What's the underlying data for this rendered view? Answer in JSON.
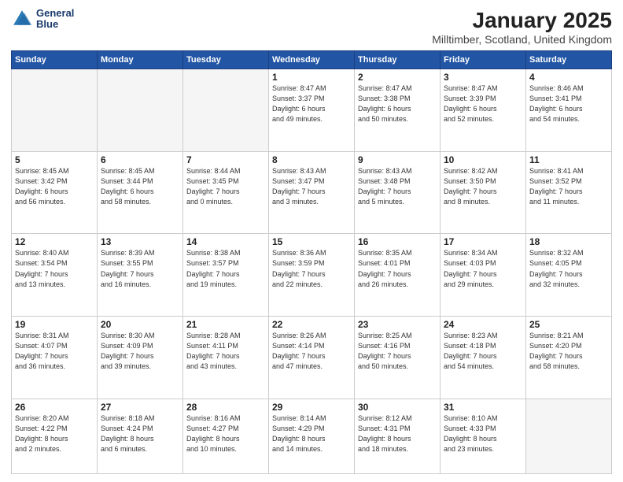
{
  "logo": {
    "line1": "General",
    "line2": "Blue"
  },
  "title": "January 2025",
  "subtitle": "Milltimber, Scotland, United Kingdom",
  "weekdays": [
    "Sunday",
    "Monday",
    "Tuesday",
    "Wednesday",
    "Thursday",
    "Friday",
    "Saturday"
  ],
  "weeks": [
    [
      {
        "day": "",
        "info": ""
      },
      {
        "day": "",
        "info": ""
      },
      {
        "day": "",
        "info": ""
      },
      {
        "day": "1",
        "info": "Sunrise: 8:47 AM\nSunset: 3:37 PM\nDaylight: 6 hours\nand 49 minutes."
      },
      {
        "day": "2",
        "info": "Sunrise: 8:47 AM\nSunset: 3:38 PM\nDaylight: 6 hours\nand 50 minutes."
      },
      {
        "day": "3",
        "info": "Sunrise: 8:47 AM\nSunset: 3:39 PM\nDaylight: 6 hours\nand 52 minutes."
      },
      {
        "day": "4",
        "info": "Sunrise: 8:46 AM\nSunset: 3:41 PM\nDaylight: 6 hours\nand 54 minutes."
      }
    ],
    [
      {
        "day": "5",
        "info": "Sunrise: 8:45 AM\nSunset: 3:42 PM\nDaylight: 6 hours\nand 56 minutes."
      },
      {
        "day": "6",
        "info": "Sunrise: 8:45 AM\nSunset: 3:44 PM\nDaylight: 6 hours\nand 58 minutes."
      },
      {
        "day": "7",
        "info": "Sunrise: 8:44 AM\nSunset: 3:45 PM\nDaylight: 7 hours\nand 0 minutes."
      },
      {
        "day": "8",
        "info": "Sunrise: 8:43 AM\nSunset: 3:47 PM\nDaylight: 7 hours\nand 3 minutes."
      },
      {
        "day": "9",
        "info": "Sunrise: 8:43 AM\nSunset: 3:48 PM\nDaylight: 7 hours\nand 5 minutes."
      },
      {
        "day": "10",
        "info": "Sunrise: 8:42 AM\nSunset: 3:50 PM\nDaylight: 7 hours\nand 8 minutes."
      },
      {
        "day": "11",
        "info": "Sunrise: 8:41 AM\nSunset: 3:52 PM\nDaylight: 7 hours\nand 11 minutes."
      }
    ],
    [
      {
        "day": "12",
        "info": "Sunrise: 8:40 AM\nSunset: 3:54 PM\nDaylight: 7 hours\nand 13 minutes."
      },
      {
        "day": "13",
        "info": "Sunrise: 8:39 AM\nSunset: 3:55 PM\nDaylight: 7 hours\nand 16 minutes."
      },
      {
        "day": "14",
        "info": "Sunrise: 8:38 AM\nSunset: 3:57 PM\nDaylight: 7 hours\nand 19 minutes."
      },
      {
        "day": "15",
        "info": "Sunrise: 8:36 AM\nSunset: 3:59 PM\nDaylight: 7 hours\nand 22 minutes."
      },
      {
        "day": "16",
        "info": "Sunrise: 8:35 AM\nSunset: 4:01 PM\nDaylight: 7 hours\nand 26 minutes."
      },
      {
        "day": "17",
        "info": "Sunrise: 8:34 AM\nSunset: 4:03 PM\nDaylight: 7 hours\nand 29 minutes."
      },
      {
        "day": "18",
        "info": "Sunrise: 8:32 AM\nSunset: 4:05 PM\nDaylight: 7 hours\nand 32 minutes."
      }
    ],
    [
      {
        "day": "19",
        "info": "Sunrise: 8:31 AM\nSunset: 4:07 PM\nDaylight: 7 hours\nand 36 minutes."
      },
      {
        "day": "20",
        "info": "Sunrise: 8:30 AM\nSunset: 4:09 PM\nDaylight: 7 hours\nand 39 minutes."
      },
      {
        "day": "21",
        "info": "Sunrise: 8:28 AM\nSunset: 4:11 PM\nDaylight: 7 hours\nand 43 minutes."
      },
      {
        "day": "22",
        "info": "Sunrise: 8:26 AM\nSunset: 4:14 PM\nDaylight: 7 hours\nand 47 minutes."
      },
      {
        "day": "23",
        "info": "Sunrise: 8:25 AM\nSunset: 4:16 PM\nDaylight: 7 hours\nand 50 minutes."
      },
      {
        "day": "24",
        "info": "Sunrise: 8:23 AM\nSunset: 4:18 PM\nDaylight: 7 hours\nand 54 minutes."
      },
      {
        "day": "25",
        "info": "Sunrise: 8:21 AM\nSunset: 4:20 PM\nDaylight: 7 hours\nand 58 minutes."
      }
    ],
    [
      {
        "day": "26",
        "info": "Sunrise: 8:20 AM\nSunset: 4:22 PM\nDaylight: 8 hours\nand 2 minutes."
      },
      {
        "day": "27",
        "info": "Sunrise: 8:18 AM\nSunset: 4:24 PM\nDaylight: 8 hours\nand 6 minutes."
      },
      {
        "day": "28",
        "info": "Sunrise: 8:16 AM\nSunset: 4:27 PM\nDaylight: 8 hours\nand 10 minutes."
      },
      {
        "day": "29",
        "info": "Sunrise: 8:14 AM\nSunset: 4:29 PM\nDaylight: 8 hours\nand 14 minutes."
      },
      {
        "day": "30",
        "info": "Sunrise: 8:12 AM\nSunset: 4:31 PM\nDaylight: 8 hours\nand 18 minutes."
      },
      {
        "day": "31",
        "info": "Sunrise: 8:10 AM\nSunset: 4:33 PM\nDaylight: 8 hours\nand 23 minutes."
      },
      {
        "day": "",
        "info": ""
      }
    ]
  ],
  "colors": {
    "header_bg": "#2255a4",
    "header_text": "#ffffff",
    "empty_cell_bg": "#f5f5f5"
  }
}
